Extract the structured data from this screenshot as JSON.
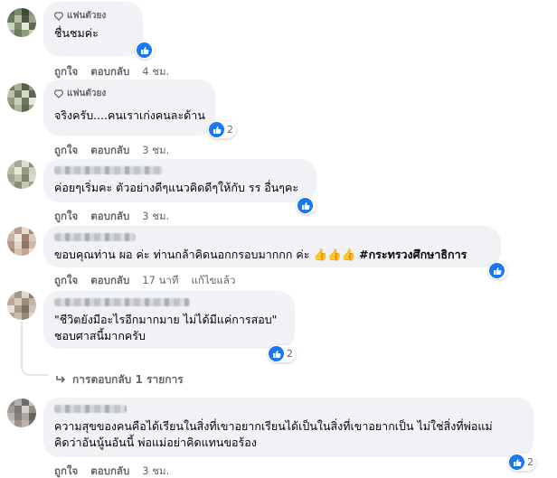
{
  "comments": [
    {
      "fan_badge": "แฟนตัวยง",
      "text": [
        "ชื่นชมค่ะ"
      ],
      "reaction_count": "",
      "actions": {
        "like": "ถูกใจ",
        "reply": "ตอบกลับ",
        "time": "4 ชม."
      }
    },
    {
      "fan_badge": "แฟนตัวยง",
      "text": [
        "จริงครับ....คนเราเก่งคนละด้าน"
      ],
      "reaction_count": "2",
      "actions": {
        "like": "ถูกใจ",
        "reply": "ตอบกลับ",
        "time": "3 ชม."
      }
    },
    {
      "text": [
        "ค่อยๆเริ่มคะ ตัวอย่างดีๆแนวคิดดีๆให้กับ รร อื่นๆคะ"
      ],
      "reaction_count": "",
      "actions": {
        "like": "ถูกใจ",
        "reply": "ตอบกลับ",
        "time": "3 ชม."
      }
    },
    {
      "text_main": "ขอบคุณท่าน ผอ ค่ะ ท่านกล้าคิดนอกกรอบมากกก ค่ะ 👍👍👍 ",
      "hashtag": "#กระทรวงศึกษาธิการ",
      "reaction_count": "",
      "actions": {
        "like": "ถูกใจ",
        "reply": "ตอบกลับ",
        "time": "17 นาที",
        "edited": "แก้ไขแล้ว"
      }
    },
    {
      "text": [
        "\"ชีวิตยังมีอะไรอีกมากมาย ไม่ได้มีแค่การสอบ\"",
        "ชอบศาสนี้มากครับ"
      ],
      "reaction_count": "2",
      "replies_link": "การตอบกลับ 1 รายการ"
    },
    {
      "text": [
        "ความสุขของคนคือได้เรียนในสิ่งที่เขาอยากเรียนได้เป็นในสิ่งที่เขาอยากเป็น ไม่ใช่สิ่งที่พ่อแม่",
        "คิดว่าอันนู้นอันนี้ พ่อแม่อย่าคิดแทนขอร้อง"
      ],
      "reaction_count": "2",
      "actions": {
        "like": "ถูกใจ",
        "reply": "ตอบกลับ",
        "time": "3 ชม."
      }
    }
  ],
  "colors": {
    "bubble": "#f0f2f5",
    "like_blue": "#1877f2",
    "meta_gray": "#65676b",
    "text": "#050505"
  },
  "icons": [
    "diamond-fan-icon",
    "like-thumb-icon",
    "reply-arrow-icon"
  ]
}
